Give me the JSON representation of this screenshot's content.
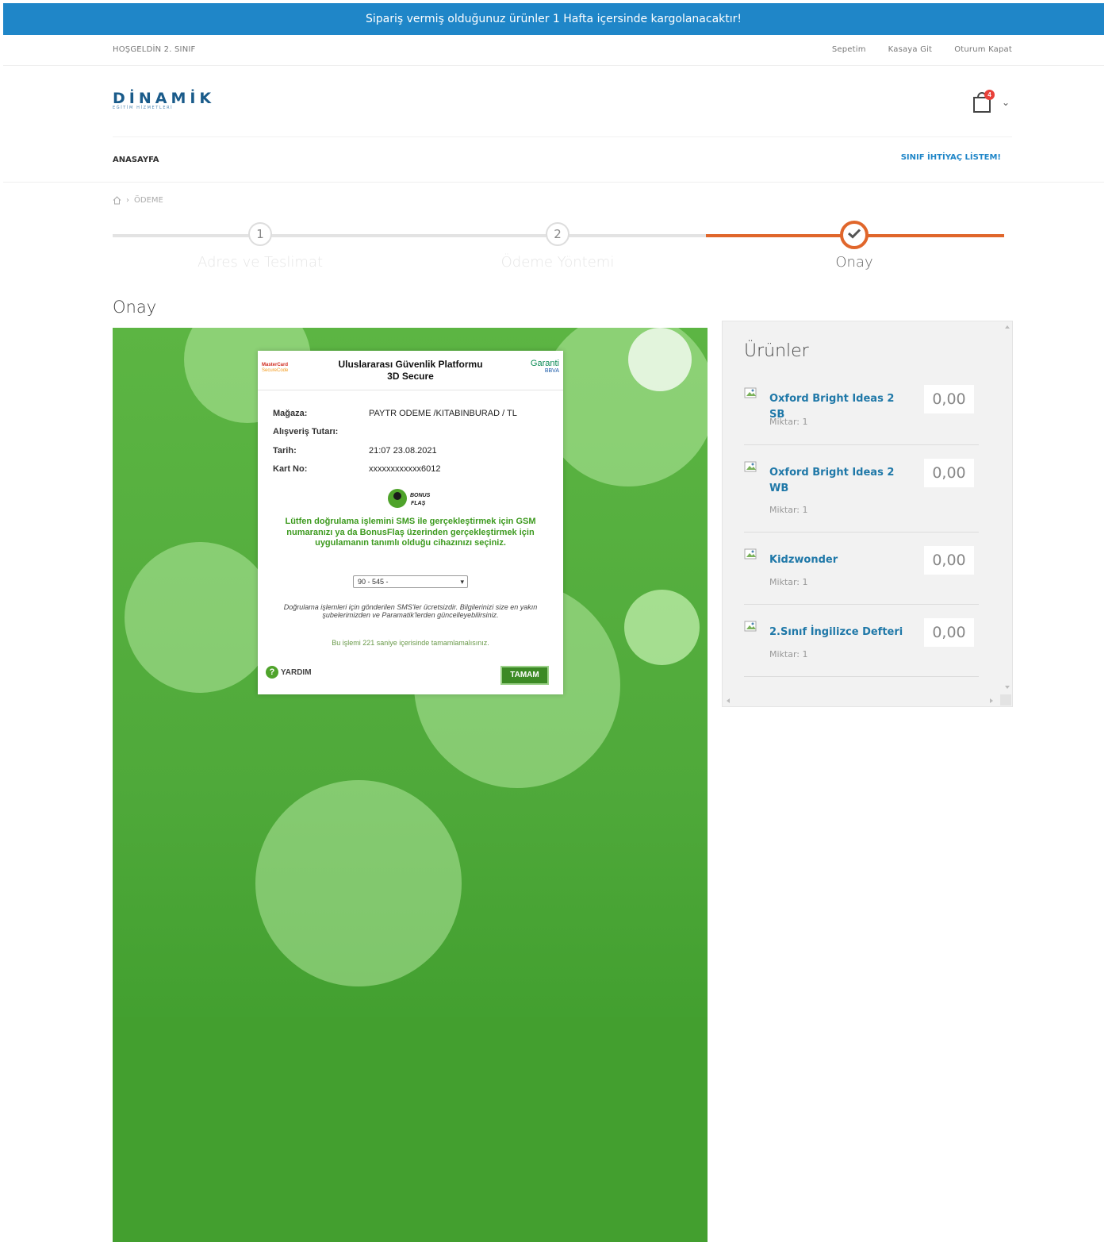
{
  "announcement": "Sipariş vermiş olduğunuz ürünler 1 Hafta içersinde kargolanacaktır!",
  "topbar": {
    "welcome": "HOŞGELDİN 2. SINIF",
    "links": [
      "Sepetim",
      "Kasaya Git",
      "Oturum Kapat"
    ]
  },
  "logo": {
    "name": "DİNAMİK",
    "tagline": "EĞİTİM HİZMETLERİ"
  },
  "cart": {
    "count": "4"
  },
  "nav": {
    "home": "ANASAYFA",
    "needs_list": "SINIF İHTİYAÇ LİSTEM!"
  },
  "breadcrumb": {
    "current": "ÖDEME"
  },
  "steps": [
    {
      "number": "1",
      "label": "Adres ve Teslimat",
      "state": "pending"
    },
    {
      "number": "2",
      "label": "Ödeme Yöntemi",
      "state": "pending"
    },
    {
      "number": "✔",
      "label": "Onay",
      "state": "active"
    }
  ],
  "colors": {
    "accent": "#e0662b",
    "brand": "#1f86c8",
    "success": "#3d9a1f"
  },
  "section_title": "Onay",
  "secure_dialog": {
    "brand_left": "MasterCard",
    "brand_left_sub": "SecureCode",
    "title": "Uluslararası Güvenlik Platformu 3D Secure",
    "bank": "Garanti",
    "bank_sub": "BBVA",
    "fields": [
      {
        "label": "Mağaza:",
        "value": "PAYTR ODEME /KITABINBURAD / TL"
      },
      {
        "label": "Alışveriş Tutarı:",
        "value": ""
      },
      {
        "label": "Tarih:",
        "value": "21:07 23.08.2021"
      },
      {
        "label": "Kart No:",
        "value": "xxxxxxxxxxxx6012"
      }
    ],
    "bonus_label": "BONUS FLAŞ",
    "message": "Lütfen doğrulama işlemini SMS ile gerçekleştirmek için GSM numaranızı ya da BonusFlaş üzerinden gerçekleştirmek için uygulamanın tanımlı olduğu cihazınızı seçiniz.",
    "select_value": "90 - 545 -",
    "note": "Doğrulama işlemleri için gönderilen SMS'ler ücretsizdir. Bilgilerinizi size en yakın şubelerimizden ve Paramatik'lerden güncelleyebilirsiniz.",
    "timer": "Bu işlemi 221 saniye içerisinde tamamlamalısınız.",
    "help": "YARDIM",
    "ok": "TAMAM"
  },
  "products": {
    "title": "Ürünler",
    "items": [
      {
        "name": "Oxford Bright Ideas 2 SB",
        "qty": "Miktar: 1",
        "price": "0,00"
      },
      {
        "name": "Oxford Bright Ideas 2 WB",
        "qty": "Miktar: 1",
        "price": "0,00"
      },
      {
        "name": "Kidzwonder",
        "qty": "Miktar: 1",
        "price": "0,00"
      },
      {
        "name": "2.Sınıf İngilizce Defteri",
        "qty": "Miktar: 1",
        "price": "0,00"
      }
    ]
  }
}
